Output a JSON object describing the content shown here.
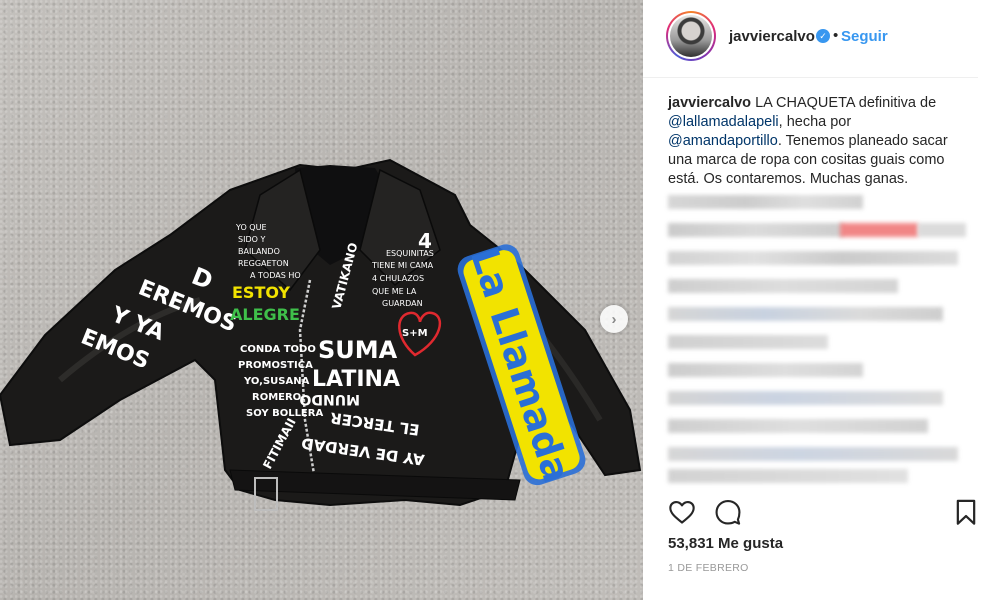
{
  "post": {
    "username": "javviercalvo",
    "verified": true,
    "separator": "•",
    "follow_label": "Seguir",
    "caption": {
      "username": "javviercalvo",
      "text_1": " LA CHAQUETA definitiva de ",
      "mention_1": "@lallamadalapeli",
      "text_2": ", hecha por ",
      "mention_2": "@amandaportillo",
      "text_3": ". Tenemos planeado sacar una marca de ropa con cositas guais como está. Os contaremos. Muchas ganas."
    },
    "likes": "53,831 Me gusta",
    "date": "1 DE FEBRERO"
  },
  "photo": {
    "next_arrow": "›",
    "jacket_text": {
      "left_sleeve_1": "D",
      "left_sleeve_2": "EREMOS",
      "left_sleeve_3": "Y YA",
      "left_sleeve_4": "EMOS",
      "estoy": "ESTOY",
      "alegre": "ALEGRE",
      "yo_que": "YO QUE",
      "sido": "SIDO Y",
      "bailando": "BAILANDO",
      "reggaeton": "REGGAETON",
      "a_todas": "A TODAS HO",
      "vatikano": "VATIKANO",
      "four": "4",
      "esquinitas": "ESQUINITAS",
      "tiene_mi_cama": "TIENE MI CAMA",
      "chulazos": "4 CHULAZOS",
      "que_me_la": "QUE ME LA",
      "guardan": "GUARDAN",
      "s_m": "S+M",
      "suma": "SUMA",
      "latina": "LATINA",
      "conda_todo": "CONDA TODO",
      "promostica": "PROMOSTICA",
      "yo_susana": "YO,SUSANA",
      "romero": "ROMERO.",
      "soy_bollera": "SOY BOLLERA",
      "mundo": "MUNDO",
      "el_tercer": "EL TERCER",
      "ay_de_verdad": "AY DE VERDAD",
      "fitimaii": "FITIMAII",
      "la_llamada": "La Llamada"
    }
  },
  "colors": {
    "accent": "#3897f0",
    "mention": "#003569",
    "muted": "#999999",
    "jacket_yellow": "#f2e300",
    "jacket_blue": "#2a6fd6",
    "heart": "#e0292f"
  },
  "icons": {
    "heart": "heart-icon",
    "comment": "comment-icon",
    "bookmark": "bookmark-icon",
    "verified": "verified-badge-icon",
    "next": "chevron-right-icon"
  }
}
